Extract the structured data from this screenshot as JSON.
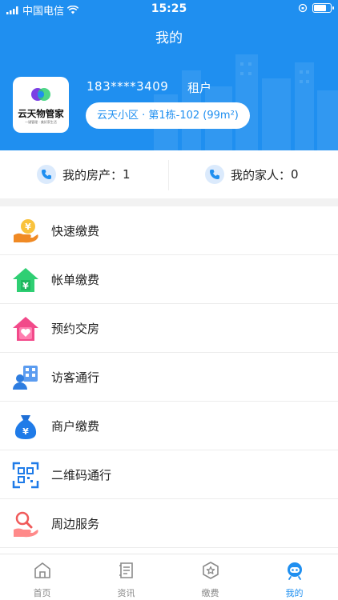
{
  "status_bar": {
    "carrier": "中国电信",
    "time": "15:25",
    "battery_level": 0.8
  },
  "header": {
    "title": "我的",
    "logo": {
      "name": "云天物管家",
      "slogan": "一键管理 · 美好家生活"
    },
    "phone": "183****3409",
    "role": "租户",
    "address": "云天小区 · 第1栋-102 (99m²)"
  },
  "stats": {
    "property_label": "我的房产：",
    "property_count": "1",
    "family_label": "我的家人：",
    "family_count": "0"
  },
  "menu": [
    {
      "label": "快速缴费",
      "icon": "coin-hand-icon"
    },
    {
      "label": "帐单缴费",
      "icon": "house-yuan-icon"
    },
    {
      "label": "预约交房",
      "icon": "house-heart-icon"
    },
    {
      "label": "访客通行",
      "icon": "visitor-icon"
    },
    {
      "label": "商户缴费",
      "icon": "money-bag-icon"
    },
    {
      "label": "二维码通行",
      "icon": "qrcode-icon"
    },
    {
      "label": "周边服务",
      "icon": "search-hand-icon"
    }
  ],
  "tabs": [
    {
      "label": "首页",
      "icon": "home-icon"
    },
    {
      "label": "资讯",
      "icon": "news-icon"
    },
    {
      "label": "缴费",
      "icon": "payment-icon"
    },
    {
      "label": "我的",
      "icon": "profile-icon",
      "active": true
    }
  ],
  "colors": {
    "primary": "#1f8ff0",
    "orange": "#f5a524",
    "green": "#2fcf73",
    "pink": "#f24a8a"
  }
}
